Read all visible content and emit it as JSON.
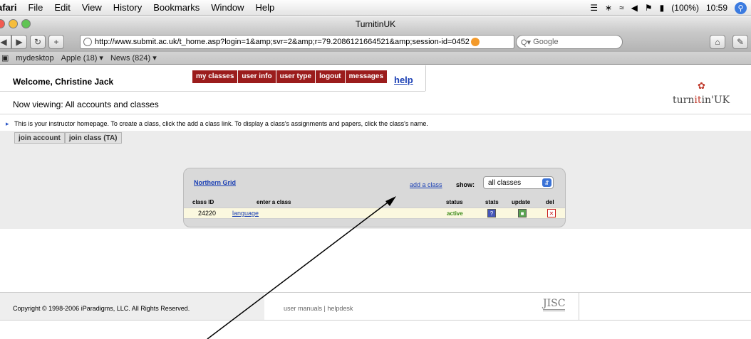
{
  "menubar": {
    "app": "afari",
    "items": [
      "File",
      "Edit",
      "View",
      "History",
      "Bookmarks",
      "Window",
      "Help"
    ],
    "battery": "(100%)",
    "clock": "10:59"
  },
  "window": {
    "title": "TurnitinUK"
  },
  "toolbar": {
    "url": "http://www.submit.ac.uk/t_home.asp?login=1&amp;svr=2&amp;r=79.2086121664521&amp;session-id=0452",
    "search_placeholder": "Google"
  },
  "bookmarks": {
    "items": [
      "mydesktop",
      "Apple (18) ▾",
      "News (824) ▾"
    ]
  },
  "header": {
    "welcome": "Welcome, Christine Jack",
    "nav": [
      "my classes",
      "user info",
      "user type",
      "logout",
      "messages"
    ],
    "help": "help",
    "logo_turn": "turn",
    "logo_it": "it",
    "logo_in": "in",
    "logo_uk": "UK"
  },
  "page": {
    "now_viewing": "Now viewing: All accounts and classes",
    "info": "This is your instructor homepage. To create a class, click the add a class link. To display a class's assignments and papers, click the class's name.",
    "join_buttons": [
      "join account",
      "join class (TA)"
    ]
  },
  "panel": {
    "account_name": "Northern Grid",
    "add_class": "add a class",
    "show_label": "show:",
    "show_value": "all classes",
    "columns": [
      "class ID",
      "enter a class",
      "status",
      "stats",
      "update",
      "del"
    ],
    "rows": [
      {
        "class_id": "24220",
        "name": "language",
        "status": "active"
      }
    ]
  },
  "footer": {
    "copyright": "Copyright © 1998-2006 iParadigms, LLC. All Rights Reserved.",
    "links": "user manuals | helpdesk",
    "jisc": "JISC"
  }
}
